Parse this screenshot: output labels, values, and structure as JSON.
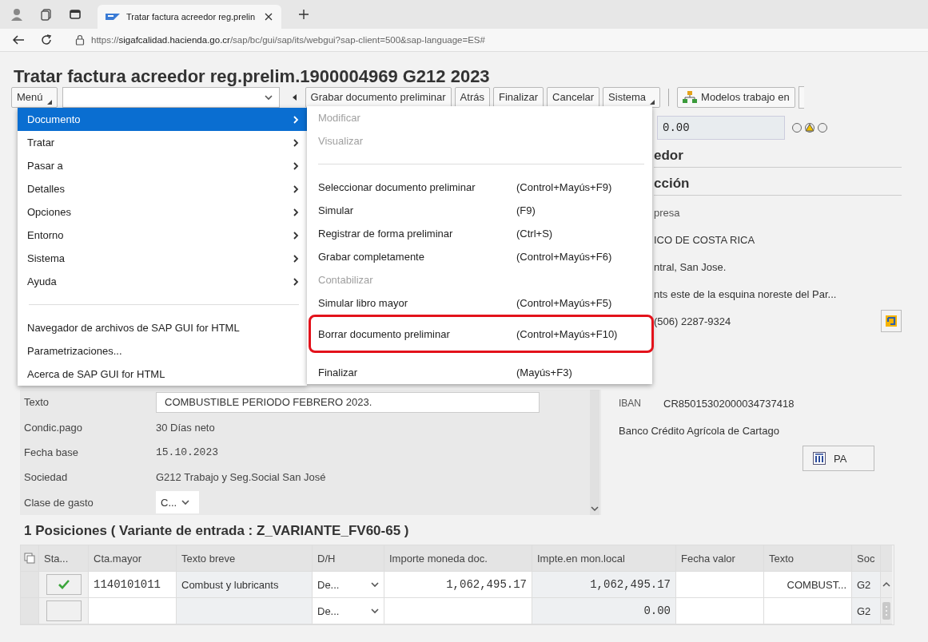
{
  "browser": {
    "tab_title": "Tratar factura acreedor reg.prelin",
    "url": "https://**sigafcalidad.hacienda.go.cr**/sap/bc/gui/sap/its/webgui?sap-client=500&sap-language=ES#"
  },
  "window": {
    "title": "Tratar factura acreedor reg.prelim.1900004969 G212 2023"
  },
  "toolbar": {
    "menu_button": "Menú",
    "buttons": [
      {
        "label": "Grabar documento preliminar",
        "kind": "plain"
      },
      {
        "label": "Atrás",
        "kind": "plain"
      },
      {
        "label": "Finalizar",
        "kind": "plain"
      },
      {
        "label": "Cancelar",
        "kind": "plain"
      },
      {
        "label": "Sistema",
        "kind": "menu"
      },
      {
        "label": "Modelos trabajo en",
        "kind": "icon"
      }
    ]
  },
  "menu": {
    "groups": [
      {
        "items": [
          {
            "label": "Documento",
            "submenu": true,
            "selected": true
          },
          {
            "label": "Tratar",
            "submenu": true,
            "selected": false
          },
          {
            "label": "Pasar a",
            "submenu": true,
            "selected": false
          },
          {
            "label": "Detalles",
            "submenu": true,
            "selected": false
          },
          {
            "label": "Opciones",
            "submenu": true,
            "selected": false
          },
          {
            "label": "Entorno",
            "submenu": true,
            "selected": false
          },
          {
            "label": "Sistema",
            "submenu": true,
            "selected": false
          },
          {
            "label": "Ayuda",
            "submenu": true,
            "selected": false
          }
        ]
      },
      {
        "items": [
          {
            "label": "Navegador de archivos de SAP GUI for HTML",
            "submenu": false,
            "selected": false
          },
          {
            "label": "Parametrizaciones...",
            "submenu": false,
            "selected": false
          },
          {
            "label": "Acerca de SAP GUI for HTML",
            "submenu": false,
            "selected": false
          }
        ]
      }
    ]
  },
  "submenu": {
    "groups": [
      {
        "items": [
          {
            "label": "Modificar",
            "disabled": true,
            "highlighted": false
          },
          {
            "label": "Visualizar",
            "disabled": true,
            "highlighted": false
          }
        ]
      },
      {
        "items": [
          {
            "label": "Seleccionar documento preliminar",
            "shortcut": "(Control+Mayús+F9)",
            "disabled": false,
            "highlighted": false
          },
          {
            "label": "Simular",
            "shortcut": "(F9)",
            "disabled": false,
            "highlighted": false
          },
          {
            "label": "Registrar de forma preliminar",
            "shortcut": "(Ctrl+S)",
            "disabled": false,
            "highlighted": false
          },
          {
            "label": "Grabar completamente",
            "shortcut": "(Control+Mayús+F6)",
            "disabled": false,
            "highlighted": false
          },
          {
            "label": "Contabilizar",
            "disabled": true,
            "highlighted": false
          },
          {
            "label": "Simular libro mayor",
            "shortcut": "(Control+Mayús+F5)",
            "disabled": false,
            "highlighted": false
          },
          {
            "label": "Borrar documento preliminar",
            "shortcut": "(Control+Mayús+F10)",
            "disabled": false,
            "highlighted": true
          }
        ]
      },
      {
        "items": [
          {
            "label": "Finalizar",
            "shortcut": "(Mayús+F3)",
            "disabled": false,
            "highlighted": false
          }
        ]
      }
    ]
  },
  "vendor_panel": {
    "amount": "0.00",
    "headings": [
      "edor",
      "cción"
    ],
    "lines": [
      {
        "text": "presa",
        "kind": "label"
      },
      {
        "text": "ICO DE COSTA RICA",
        "kind": "text"
      },
      {
        "text": "ntral, San Jose.",
        "kind": "text"
      },
      {
        "text": "nts este de la esquina noreste del Par...",
        "kind": "text"
      },
      {
        "text": "(506) 2287-9324",
        "kind": "phone"
      }
    ],
    "iban_label": "IBAN",
    "iban": "CR85015302000034737418",
    "bank": "Banco Crédito Agrícola de Cartago",
    "pa_button": "PA"
  },
  "form": {
    "rows": [
      {
        "label": "Texto",
        "value": "COMBUSTIBLE PERIODO FEBRERO 2023.",
        "kind": "input"
      },
      {
        "label": "Condic.pago",
        "value": "30 Días neto",
        "kind": "text"
      },
      {
        "label": "Fecha base",
        "value": "15.10.2023",
        "kind": "mono"
      },
      {
        "label": "Sociedad",
        "value": "G212 Trabajo y Seg.Social San José",
        "kind": "text"
      },
      {
        "label": "Clase de gasto",
        "value": "C...",
        "kind": "dropdown"
      }
    ]
  },
  "items_section": {
    "title": "1 Posiciones ( Variante de entrada : Z_VARIANTE_FV60-65 )"
  },
  "table": {
    "columns": [
      {
        "label": "Sta...",
        "kind": "status"
      },
      {
        "label": "Cta.mayor",
        "kind": "input-mono"
      },
      {
        "label": "Texto breve",
        "kind": "readonly"
      },
      {
        "label": "D/H",
        "kind": "dropdown"
      },
      {
        "label": "Importe moneda doc.",
        "kind": "amount-input"
      },
      {
        "label": "Impte.en mon.local",
        "kind": "amount-readonly"
      },
      {
        "label": "Fecha valor",
        "kind": "input"
      },
      {
        "label": "Texto",
        "kind": "input-right"
      },
      {
        "label": "Soc",
        "kind": "readonly"
      }
    ],
    "rows": [
      {
        "status_ok": true,
        "cells": [
          null,
          "1140101011",
          "Combust y lubricants",
          "De...",
          "1,062,495.17",
          "1,062,495.17",
          null,
          "COMBUST...",
          "G2"
        ]
      },
      {
        "status_ok": false,
        "cells": [
          null,
          null,
          null,
          "De...",
          null,
          "0.00",
          null,
          null,
          "G2"
        ]
      }
    ]
  }
}
